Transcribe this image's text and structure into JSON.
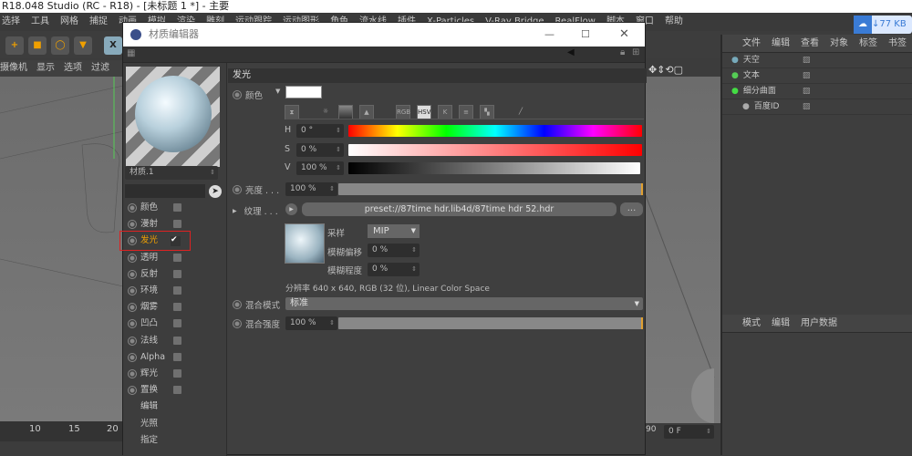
{
  "app": {
    "title": "R18.048 Studio (RC - R18) - [未标题 1 *] - 主要"
  },
  "menubar": [
    "选择",
    "工具",
    "网格",
    "捕捉",
    "动画",
    "模拟",
    "渲染",
    "雕刻",
    "运动跟踪",
    "运动图形",
    "角色",
    "流水线",
    "插件",
    "X-Particles",
    "V-Ray Bridge",
    "RealFlow",
    "脚本",
    "窗口",
    "帮助"
  ],
  "view_menu": [
    "摄像机",
    "显示",
    "选项",
    "过滤"
  ],
  "timeline": {
    "ticks": [
      "10",
      "15",
      "20"
    ],
    "end": "90",
    "frame": "0 F"
  },
  "download_badge": "77 KB",
  "object_manager": {
    "menu": [
      "文件",
      "编辑",
      "查看",
      "对象",
      "标签",
      "书签"
    ],
    "objects": [
      "天空",
      "文本",
      "细分曲面",
      "百度ID"
    ]
  },
  "attributes": {
    "menu": [
      "模式",
      "编辑",
      "用户数据"
    ]
  },
  "dialog": {
    "title": "材质编辑器",
    "material_name": "材质.1",
    "channels": [
      {
        "label": "颜色",
        "checked": false
      },
      {
        "label": "漫射",
        "checked": false
      },
      {
        "label": "发光",
        "checked": true,
        "active": true
      },
      {
        "label": "透明",
        "checked": false
      },
      {
        "label": "反射",
        "checked": false
      },
      {
        "label": "环境",
        "checked": false
      },
      {
        "label": "烟雾",
        "checked": false
      },
      {
        "label": "凹凸",
        "checked": false
      },
      {
        "label": "法线",
        "checked": false
      },
      {
        "label": "Alpha",
        "checked": false
      },
      {
        "label": "辉光",
        "checked": false
      },
      {
        "label": "置换",
        "checked": false
      }
    ],
    "extra": [
      "编辑",
      "光照",
      "指定"
    ],
    "section": "发光",
    "color_label": "颜色",
    "color_value": "#ffffff",
    "mode_icons": [
      "RGB",
      "HSV",
      "K"
    ],
    "hsv": {
      "h_label": "H",
      "h": "0 °",
      "s_label": "S",
      "s": "0 %",
      "v_label": "V",
      "v": "100 %"
    },
    "brightness": {
      "label": "亮度 . . .",
      "value": "100 %",
      "fraction": 1.0
    },
    "texture": {
      "label": "纹理 . . .",
      "path": "preset://87time hdr.lib4d/87time hdr 52.hdr",
      "more": "...",
      "sampling_label": "采样",
      "sampling": "MIP",
      "blur_offset_label": "模糊偏移",
      "blur_offset": "0 %",
      "blur_scale_label": "模糊程度",
      "blur_scale": "0 %",
      "info": "分辨率 640 x 640, RGB (32 位), Linear Color Space"
    },
    "mix_mode": {
      "label": "混合模式",
      "value": "标准"
    },
    "mix_strength": {
      "label": "混合强度",
      "value": "100 %",
      "fraction": 1.0
    }
  }
}
